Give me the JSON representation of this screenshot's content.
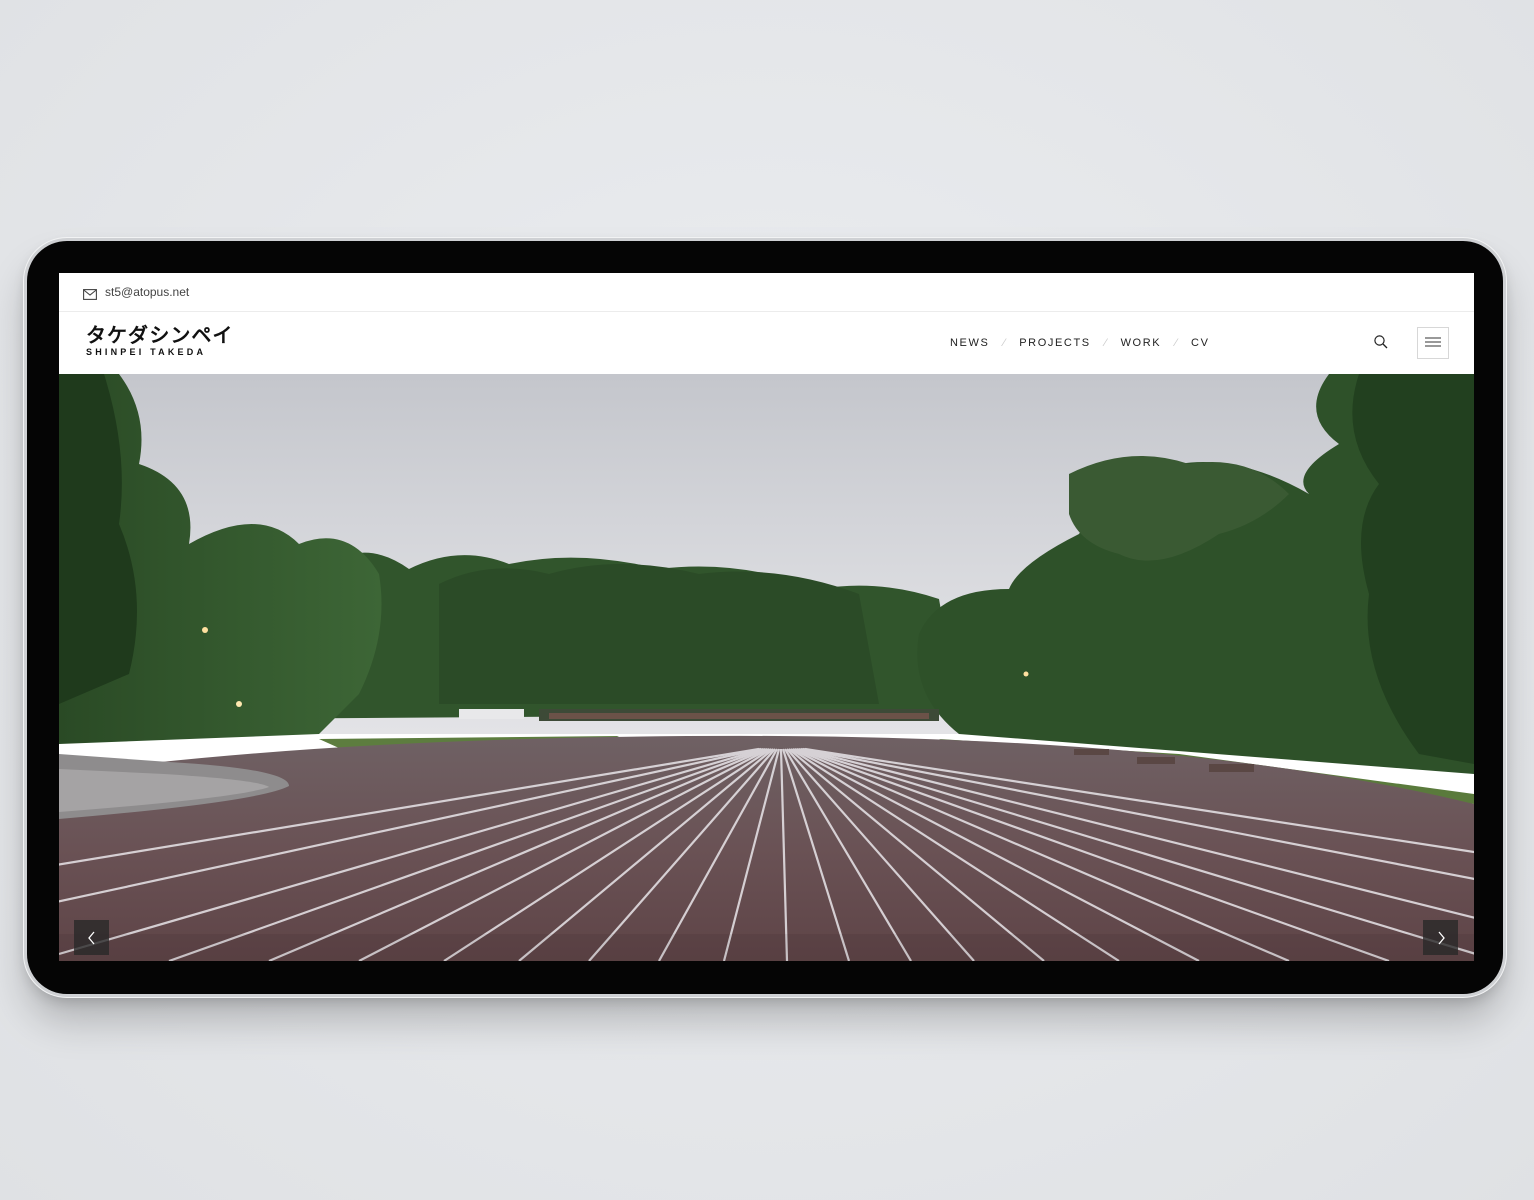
{
  "topbar": {
    "email": "st5@atopus.net",
    "email_icon": "envelope-icon"
  },
  "logo": {
    "japanese": "タケダシンペイ",
    "english": "SHINPEI TAKEDA"
  },
  "nav": {
    "items": [
      {
        "label": "NEWS"
      },
      {
        "label": "PROJECTS"
      },
      {
        "label": "WORK"
      },
      {
        "label": "CV"
      }
    ],
    "separator": "⁄"
  },
  "icons": {
    "search": "search-icon",
    "menu": "hamburger-menu-icon",
    "prev": "chevron-left-icon",
    "next": "chevron-right-icon"
  },
  "colors": {
    "text": "#111111",
    "nav_separator": "#c9c9c9",
    "arrow_bg": "#282828"
  }
}
